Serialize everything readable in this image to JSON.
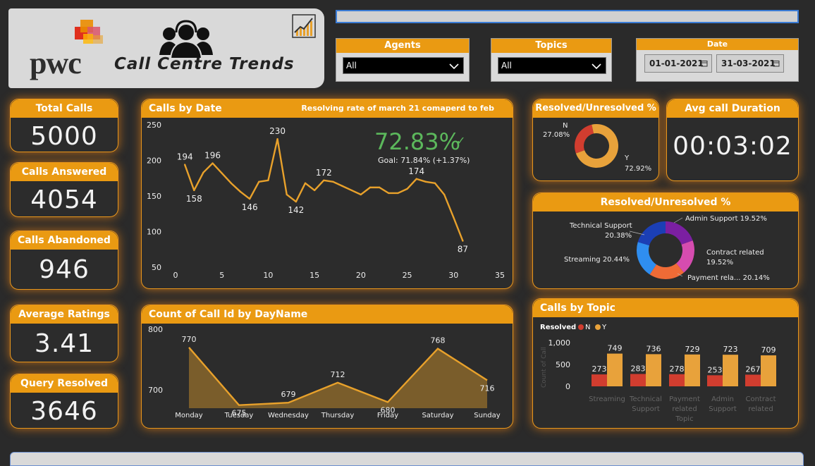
{
  "header": {
    "logo_text": "pwc",
    "title": "Call Centre Trends"
  },
  "filters": {
    "agents": {
      "label": "Agents",
      "value": "All"
    },
    "topics": {
      "label": "Topics",
      "value": "All"
    },
    "date": {
      "label": "Date",
      "start": "01-01-2021",
      "end": "31-03-2021"
    }
  },
  "kpis": {
    "total_calls": {
      "label": "Total Calls",
      "value": "5000"
    },
    "calls_answered": {
      "label": "Calls Answered",
      "value": "4054"
    },
    "calls_abandoned": {
      "label": "Calls Abandoned",
      "value": "946"
    },
    "average_ratings": {
      "label": "Average Ratings",
      "value": "3.41"
    },
    "query_resolved": {
      "label": "Query Resolved",
      "value": "3646"
    },
    "avg_call_duration": {
      "label": "Avg call Duration",
      "value": "00:03:02"
    }
  },
  "calls_by_date": {
    "title": "Calls by Date",
    "subtitle": "Resolving rate of march 21 comaperd to feb",
    "kpi_value": "72.83%",
    "kpi_goal": "Goal: 71.84% (+1.37%)",
    "kpi_check": "✓"
  },
  "resolved_pct": {
    "title": "Resolved/Unresolved %",
    "n_label": "N",
    "n_value": "27.08%",
    "y_label": "Y",
    "y_value": "72.92%"
  },
  "topic_pct": {
    "title": "Resolved/Unresolved %",
    "labels": {
      "admin": "Admin Support 19.52%",
      "tech_1": "Technical Support",
      "tech_2": "20.38%",
      "streaming": "Streaming 20.44%",
      "contract_1": "Contract related",
      "contract_2": "19.52%",
      "payment": "Payment rela... 20.14%"
    }
  },
  "day_chart": {
    "title": "Count of Call Id by DayName"
  },
  "topic_chart": {
    "title": "Calls by Topic",
    "legend_title": "Resolved",
    "legend_n": "N",
    "legend_y": "Y",
    "y_axis_label": "Count of Call"
  },
  "chart_data": [
    {
      "id": "calls_by_date",
      "type": "line",
      "x": [
        1,
        2,
        3,
        4,
        5,
        6,
        7,
        8,
        9,
        10,
        11,
        12,
        13,
        14,
        15,
        16,
        17,
        18,
        19,
        20,
        21,
        22,
        23,
        24,
        25,
        26,
        27,
        28,
        29,
        30,
        31
      ],
      "values": [
        194,
        158,
        183,
        196,
        182,
        168,
        156,
        146,
        170,
        172,
        230,
        152,
        142,
        168,
        158,
        172,
        170,
        164,
        158,
        152,
        162,
        162,
        154,
        154,
        160,
        174,
        170,
        168,
        152,
        120,
        87
      ],
      "labels": {
        "1": "194",
        "2": "158",
        "4": "196",
        "8": "146",
        "11": "230",
        "13": "142",
        "16": "172",
        "26": "174",
        "31": "87"
      },
      "xlim": [
        0,
        35
      ],
      "ylim": [
        50,
        250
      ],
      "xticks": [
        "0",
        "5",
        "10",
        "15",
        "20",
        "25",
        "30",
        "35"
      ],
      "yticks": [
        "250",
        "200",
        "150",
        "100",
        "50"
      ],
      "color": "#e8a12b"
    },
    {
      "id": "resolved_unresolved",
      "type": "pie",
      "categories": [
        "N",
        "Y"
      ],
      "values": [
        27.08,
        72.92
      ],
      "colors": [
        "#d13d2f",
        "#e8a23b"
      ]
    },
    {
      "id": "topic_share",
      "type": "pie",
      "categories": [
        "Admin Support",
        "Contract related",
        "Payment related",
        "Streaming",
        "Technical Support"
      ],
      "values": [
        19.52,
        19.52,
        20.14,
        20.44,
        20.38
      ],
      "colors": [
        "#7b1fa2",
        "#d64caf",
        "#ef6b36",
        "#2f8ef0",
        "#1b3fb5"
      ]
    },
    {
      "id": "calls_by_dayname",
      "type": "area",
      "categories": [
        "Monday",
        "Tuesday",
        "Wednesday",
        "Thursday",
        "Friday",
        "Saturday",
        "Sunday"
      ],
      "values": [
        770,
        675,
        679,
        712,
        680,
        768,
        716
      ],
      "ylim": [
        670,
        800
      ],
      "yticks": [
        "800",
        "700"
      ],
      "color": "#e8a12b"
    },
    {
      "id": "calls_by_topic",
      "type": "bar",
      "categories": [
        "Streaming",
        "Technical Support",
        "Payment related Topic",
        "Admin Support",
        "Contract related"
      ],
      "category_lines": [
        [
          "Streaming"
        ],
        [
          "Technical",
          "Support"
        ],
        [
          "Payment",
          "related",
          "Topic"
        ],
        [
          "Admin",
          "Support"
        ],
        [
          "Contract",
          "related"
        ]
      ],
      "series": [
        {
          "name": "N",
          "values": [
            273,
            283,
            278,
            253,
            267
          ],
          "color": "#d13d2f"
        },
        {
          "name": "Y",
          "values": [
            749,
            736,
            729,
            723,
            709
          ],
          "color": "#e8a23b"
        }
      ],
      "ylim": [
        0,
        1000
      ],
      "yticks": [
        "1,000",
        "500",
        "0"
      ]
    }
  ]
}
